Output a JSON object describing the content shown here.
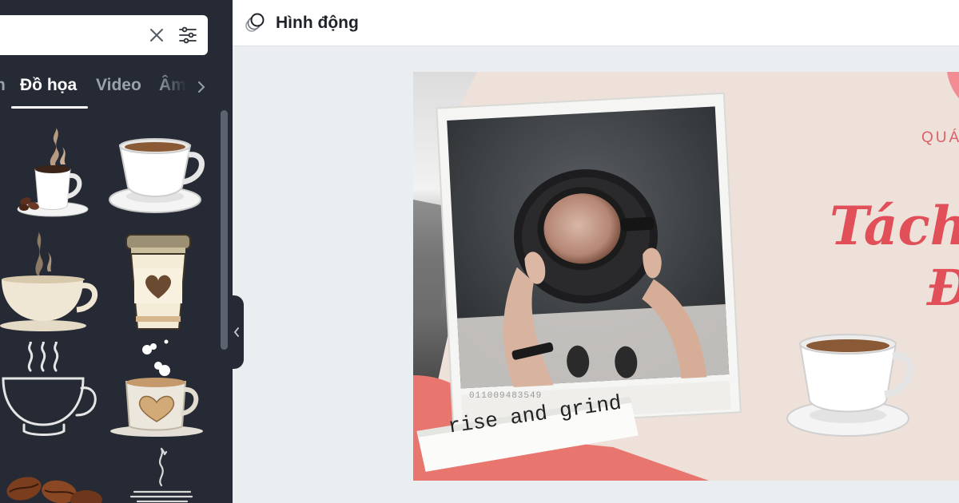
{
  "search": {
    "value": "",
    "placeholder": ""
  },
  "tabs": [
    {
      "label": "n",
      "active": false
    },
    {
      "label": "Đồ họa",
      "active": true
    },
    {
      "label": "Video",
      "active": false
    },
    {
      "label": "Âm",
      "active": false
    }
  ],
  "graphics": [
    {
      "name": "steaming-coffee-cup-with-beans",
      "icon": "coffee-cup-icon"
    },
    {
      "name": "white-coffee-cup-on-saucer",
      "icon": "coffee-cup-icon"
    },
    {
      "name": "beige-cup-with-steam",
      "icon": "coffee-cup-icon"
    },
    {
      "name": "takeaway-coffee-cup",
      "icon": "takeaway-cup-icon"
    },
    {
      "name": "outline-coffee-cup-with-steam",
      "icon": "coffee-cup-icon"
    },
    {
      "name": "heart-latte-cup",
      "icon": "coffee-cup-icon"
    },
    {
      "name": "coffee-beans",
      "icon": "coffee-bean-icon"
    },
    {
      "name": "line-art-cup-with-steam",
      "icon": "coffee-cup-icon"
    }
  ],
  "toolbar": {
    "animate_label": "Hình động"
  },
  "design": {
    "subtitle": "QUÁ",
    "headline_line1": "Tách c",
    "headline_line2": "Đ",
    "photo_caption": "rise and grind",
    "film_number": "011009483549",
    "colors": {
      "background": "#eee1d9",
      "accent": "#e14f59",
      "torn_paper": "#e8766f"
    }
  },
  "colors": {
    "panel": "#252a34",
    "canvas_bg": "#ebeef1"
  }
}
